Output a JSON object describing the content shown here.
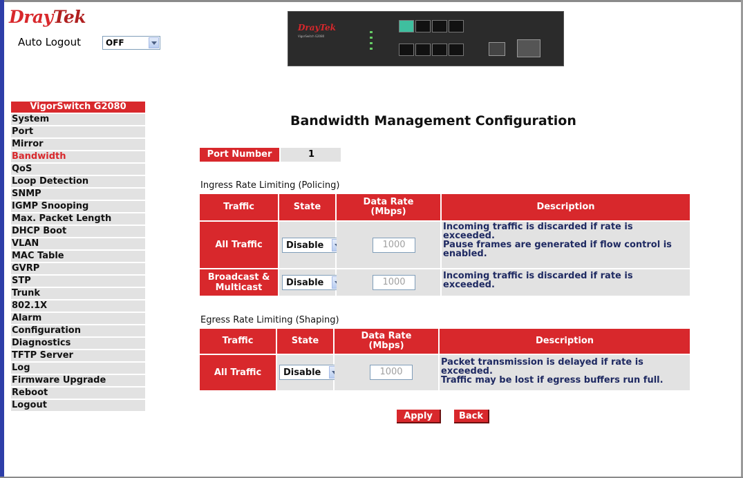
{
  "header": {
    "logo_text": "DrayTek",
    "logo_dray": "Dray",
    "logo_tek": "Tek",
    "auto_logout_label": "Auto Logout",
    "auto_logout_value": "OFF",
    "device_brand": "DrayTek",
    "device_model": "VigorSwitch G2080"
  },
  "menu": {
    "title": "VigorSwitch G2080",
    "items": [
      {
        "label": "System"
      },
      {
        "label": "Port"
      },
      {
        "label": "Mirror"
      },
      {
        "label": "Bandwidth"
      },
      {
        "label": "QoS"
      },
      {
        "label": "Loop Detection"
      },
      {
        "label": "SNMP"
      },
      {
        "label": "IGMP Snooping"
      },
      {
        "label": "Max. Packet Length"
      },
      {
        "label": "DHCP Boot"
      },
      {
        "label": "VLAN"
      },
      {
        "label": "MAC Table"
      },
      {
        "label": "GVRP"
      },
      {
        "label": "STP"
      },
      {
        "label": "Trunk"
      },
      {
        "label": "802.1X"
      },
      {
        "label": "Alarm"
      },
      {
        "label": "Configuration"
      },
      {
        "label": "Diagnostics"
      },
      {
        "label": "TFTP Server"
      },
      {
        "label": "Log"
      },
      {
        "label": "Firmware Upgrade"
      },
      {
        "label": "Reboot"
      },
      {
        "label": "Logout"
      }
    ],
    "active": "Bandwidth"
  },
  "main": {
    "title": "Bandwidth Management Configuration",
    "port_number_label": "Port Number",
    "port_number_value": "1",
    "ingress": {
      "title": "Ingress Rate Limiting (Policing)",
      "headers": {
        "traffic": "Traffic",
        "state": "State",
        "rate_line1": "Data Rate",
        "rate_line2": "(Mbps)",
        "description": "Description"
      },
      "rows": [
        {
          "traffic": "All Traffic",
          "state": "Disable",
          "rate": "1000",
          "description_lines": [
            "Incoming traffic is discarded if rate is",
            "exceeded.",
            "Pause frames are generated if flow control is",
            "enabled."
          ]
        },
        {
          "traffic_line1": "Broadcast &",
          "traffic_line2": "Multicast",
          "state": "Disable",
          "rate": "1000",
          "description_lines": [
            "Incoming traffic is discarded if rate is",
            "exceeded."
          ]
        }
      ]
    },
    "egress": {
      "title": "Egress Rate Limiting (Shaping)",
      "headers": {
        "traffic": "Traffic",
        "state": "State",
        "rate_line1": "Data Rate",
        "rate_line2": "(Mbps)",
        "description": "Description"
      },
      "rows": [
        {
          "traffic": "All Traffic",
          "state": "Disable",
          "rate": "1000",
          "description_lines": [
            "Packet transmission is delayed if rate is",
            "exceeded.",
            "Traffic may be lost if egress buffers run full."
          ]
        }
      ]
    },
    "buttons": {
      "apply": "Apply",
      "back": "Back"
    }
  },
  "colors": {
    "accent": "#d8282c",
    "cell": "#e2e2e2",
    "frame": "#2e3ea8",
    "desc_text": "#1f2a62"
  }
}
